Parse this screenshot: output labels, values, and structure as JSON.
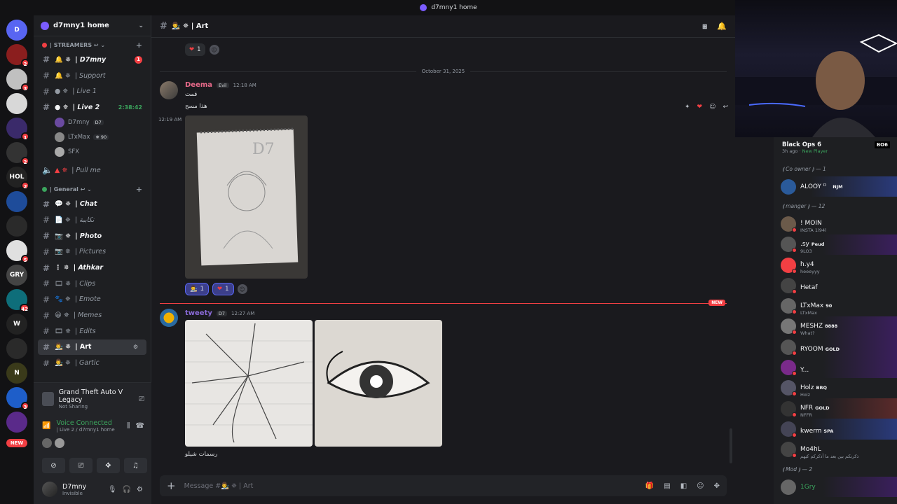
{
  "window": {
    "title": "d7mny1 home"
  },
  "servers": [
    {
      "initials": "D",
      "color": "#5865f2",
      "badge": ""
    },
    {
      "initials": "",
      "color": "#8b1e1e",
      "badge": "2"
    },
    {
      "initials": "",
      "color": "#c0c0c0",
      "badge": "3"
    },
    {
      "initials": "",
      "color": "#d8d8d8",
      "badge": ""
    },
    {
      "initials": "",
      "color": "#3a2a6a",
      "badge": "1"
    },
    {
      "initials": "",
      "color": "#333",
      "badge": "2"
    },
    {
      "initials": "HOL",
      "color": "#222",
      "badge": "2"
    },
    {
      "initials": "",
      "color": "#1e4c9a",
      "badge": ""
    },
    {
      "initials": "",
      "color": "#2a2a2a",
      "badge": ""
    },
    {
      "initials": "",
      "color": "#e0e0e0",
      "badge": "5"
    },
    {
      "initials": "GRY",
      "color": "#444",
      "badge": ""
    },
    {
      "initials": "",
      "color": "#0e6e7a",
      "badge": "42"
    },
    {
      "initials": "W",
      "color": "#222",
      "badge": ""
    },
    {
      "initials": "",
      "color": "#2a2a2a",
      "badge": ""
    },
    {
      "initials": "N",
      "color": "#3a3a1a",
      "badge": ""
    },
    {
      "initials": "",
      "color": "#1e5ec9",
      "badge": "3"
    },
    {
      "initials": "",
      "color": "#5a2a8a",
      "badge": ""
    }
  ],
  "new_pill": "NEW",
  "sidebar": {
    "server_name": "d7mny1 home",
    "categories": [
      {
        "name": "| STREAMERS ↩ ⌄"
      },
      {
        "name": "| General ↩ ⌄"
      }
    ],
    "streamer_channels": [
      {
        "name": "| D7mny",
        "prefix": "🔔 ✵",
        "badge": "1",
        "bold": true
      },
      {
        "name": "| Support",
        "prefix": "🔔 ✵",
        "badge": "",
        "bold": false
      },
      {
        "name": "| Live 1",
        "prefix": "● ✵",
        "badge": "",
        "bold": false
      },
      {
        "name": "| Live 2",
        "prefix": "● ✵",
        "timer": "2:38:42",
        "bold": true
      }
    ],
    "voice_users": [
      {
        "name": "D7mny",
        "tag": "D7"
      },
      {
        "name": "LTxMax",
        "tag": "✵ 90"
      },
      {
        "name": "SFX",
        "tag": ""
      }
    ],
    "pull_me": {
      "name": "| Pull me",
      "prefix": "▲ ✵"
    },
    "general_channels": [
      {
        "name": "| Chat",
        "prefix": "💬 ✵",
        "bold": true
      },
      {
        "name": "| نكايبة",
        "prefix": "📄 ✵",
        "bold": false
      },
      {
        "name": "| Photo",
        "prefix": "📷 ✵",
        "bold": true
      },
      {
        "name": "| Pictures",
        "prefix": "📷 ✵",
        "bold": false
      },
      {
        "name": "| Athkar",
        "prefix": "⋮ ✵",
        "bold": true
      },
      {
        "name": "| Clips",
        "prefix": "🎞 ✵",
        "bold": false
      },
      {
        "name": "| Emote",
        "prefix": "🐾 ✵",
        "bold": false
      },
      {
        "name": "| Memes",
        "prefix": "😀 ✵",
        "bold": false
      },
      {
        "name": "| Edits",
        "prefix": "🎞 ✵",
        "bold": false
      },
      {
        "name": "| Art",
        "prefix": "👨‍🎨 ✵",
        "bold": true,
        "active": true
      },
      {
        "name": "| Gartic",
        "prefix": "👨‍🎨 ✵",
        "bold": false
      }
    ]
  },
  "activity": {
    "title": "Grand Theft Auto V Legacy",
    "subtitle": "Not Sharing"
  },
  "voice": {
    "status": "Voice Connected",
    "location": "| Live 2 / d7mny1 home"
  },
  "user": {
    "name": "D7mny",
    "status": "Invisible"
  },
  "channel": {
    "name": "👨‍🎨 ✵ | Art"
  },
  "messages": {
    "date_divider": "October 31, 2025",
    "top_reaction": {
      "emoji": "❤",
      "count": "1"
    },
    "m1": {
      "author": "Deema",
      "tag": "Evil",
      "time": "12:18 AM",
      "lines": [
        "قمت",
        "هذا مسح"
      ],
      "img_time": "12:19 AM",
      "reactions": [
        {
          "emoji": "👨‍🎨",
          "count": "1"
        },
        {
          "emoji": "❤",
          "count": "1"
        }
      ]
    },
    "new_label": "NEW",
    "m2": {
      "author": "tweety",
      "tag": "D7",
      "time": "12:27 AM",
      "caption": "رسمات شيلو"
    }
  },
  "composer": {
    "placeholder": "Message #👨‍🎨 ✵ | Art"
  },
  "game_card": {
    "title": "Black Ops 6",
    "sub_time": "3h ago",
    "sub_status": "New Player",
    "logo": "BO6"
  },
  "roles": [
    {
      "name": "⟬ Co owner ⟭ — 1"
    },
    {
      "name": "⟬ manger ⟭ — 12"
    },
    {
      "name": "⟬ Mod ⟭ — 2"
    }
  ],
  "members_co": [
    {
      "name": "ALOOY ᴰ",
      "tag": "NJM",
      "sub": ""
    }
  ],
  "members_mgr": [
    {
      "name": "! MOIN",
      "tag": "",
      "sub": "INSTA 1l94l",
      "color": "#6b5a4a"
    },
    {
      "name": ".sy",
      "tag": "Peud",
      "sub": "9LO3",
      "color": "#555"
    },
    {
      "name": "h.y4",
      "tag": "",
      "sub": "heeeyyy",
      "color": "#f23f43"
    },
    {
      "name": "Hetaf",
      "tag": "",
      "sub": "",
      "color": "#444"
    },
    {
      "name": "LTxMax",
      "tag": "90",
      "sub": "LTxMax",
      "color": "#666"
    },
    {
      "name": "MESHZ",
      "tag": "8888",
      "sub": "What?",
      "color": "#777"
    },
    {
      "name": "RYOOM",
      "tag": "GOLD",
      "sub": "",
      "color": "#555"
    },
    {
      "name": "Y...",
      "tag": "",
      "sub": "",
      "color": "#7a2a8a"
    },
    {
      "name": "Holz",
      "tag": "BRQ",
      "sub": "Holz",
      "color": "#556"
    },
    {
      "name": "NFR",
      "tag": "GOLD",
      "sub": "NFFR",
      "color": "#333"
    },
    {
      "name": "kwerm",
      "tag": "SPA",
      "sub": "",
      "color": "#445"
    },
    {
      "name": "Mo4hL",
      "tag": "",
      "sub": "ذكرتكم بين بعد ما أذكركم كيهم",
      "color": "#444"
    }
  ],
  "members_mod": [
    {
      "name": "1Gry",
      "tag": "",
      "sub": ""
    }
  ],
  "colors": {
    "accent": "#5865f2",
    "danger": "#f23f43",
    "online": "#3ba55d",
    "bg": "#1a1a1e"
  }
}
